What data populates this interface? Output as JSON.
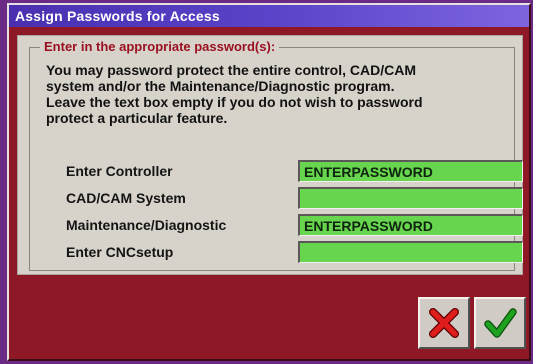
{
  "window": {
    "title": "Assign Passwords for Access"
  },
  "group": {
    "title": "Enter in the appropriate password(s):",
    "description_lines": [
      "You may password protect the entire control, CAD/CAM",
      "system and/or the Maintenance/Diagnostic program.",
      "Leave the text box empty if you do not wish to password",
      "protect a particular feature."
    ]
  },
  "fields": [
    {
      "label": "Enter Controller",
      "value": "ENTERPASSWORD"
    },
    {
      "label": "CAD/CAM System",
      "value": ""
    },
    {
      "label": "Maintenance/Diagnostic",
      "value": "ENTERPASSWORD"
    },
    {
      "label": "Enter CNCsetup",
      "value": ""
    }
  ],
  "buttons": {
    "cancel_icon": "red-x-icon",
    "ok_icon": "green-check-icon"
  },
  "colors": {
    "title_bar": "#5a43c8",
    "dialog_bg": "#8e1826",
    "panel_bg": "#d7d3cb",
    "field_bg": "#67d54d",
    "group_title": "#9a0f1f"
  }
}
